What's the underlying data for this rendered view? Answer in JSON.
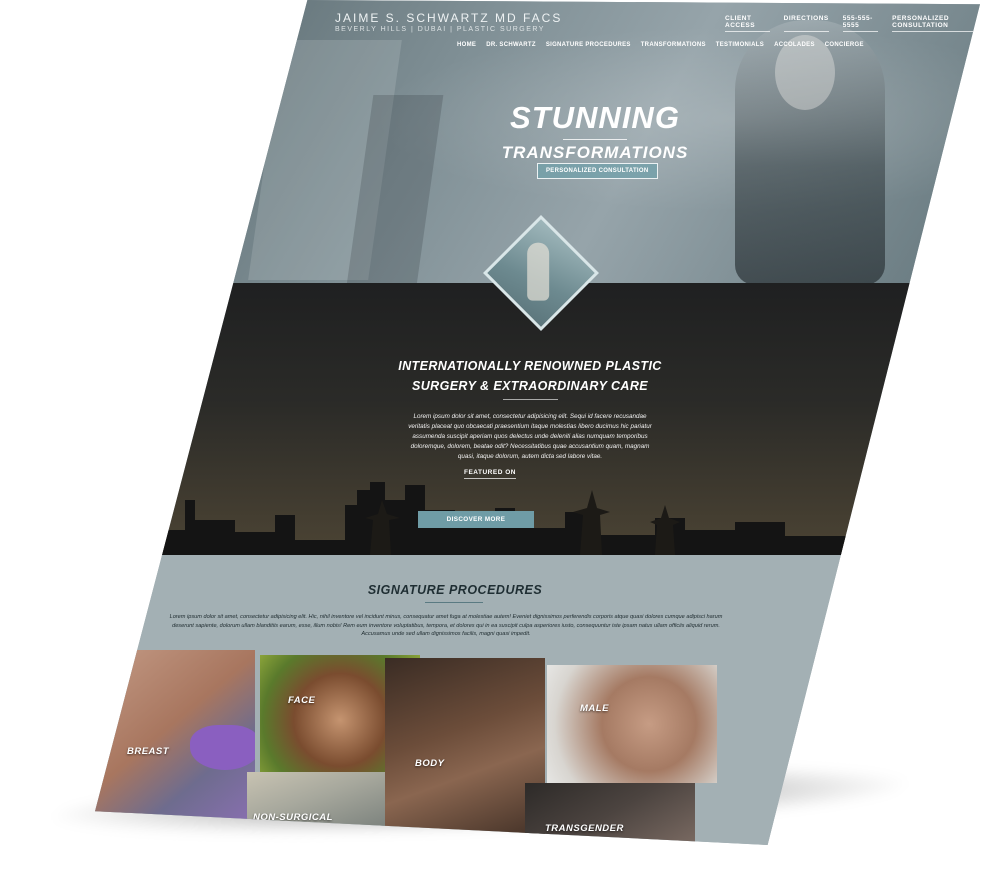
{
  "brand": {
    "name": "JAIME S. SCHWARTZ MD FACS",
    "tagline": "BEVERLY HILLS | DUBAI | PLASTIC SURGERY"
  },
  "utility_nav": [
    {
      "label": "CLIENT ACCESS"
    },
    {
      "label": "DIRECTIONS"
    },
    {
      "label": "555-555-5555"
    },
    {
      "label": "PERSONALIZED CONSULTATION"
    }
  ],
  "main_nav": [
    {
      "label": "HOME"
    },
    {
      "label": "DR. SCHWARTZ"
    },
    {
      "label": "SIGNATURE PROCEDURES"
    },
    {
      "label": "TRANSFORMATIONS"
    },
    {
      "label": "TESTIMONIALS"
    },
    {
      "label": "ACCOLADES"
    },
    {
      "label": "CONCIERGE"
    }
  ],
  "hero": {
    "headline": "STUNNING",
    "subheadline": "TRANSFORMATIONS",
    "cta": "PERSONALIZED CONSULTATION"
  },
  "intro": {
    "title_line1": "INTERNATIONALLY RENOWNED PLASTIC",
    "title_line2": "SURGERY & EXTRAORDINARY CARE",
    "body": "Lorem ipsum dolor sit amet, consectetur adipisicing elit. Sequi id facere recusandae veritatis placeat quo obcaecati praesentium itaque molestias libero ducimus hic pariatur assumenda suscipit aperiam quos delectus unde deleniti alias numquam temporibus doloremque, dolorem, beatae odit? Necessitatibus quae accusantium quam, magnam quasi, itaque dolorum, autem dicta sed labore vitae.",
    "featured_label": "FEATURED ON",
    "discover_button": "DISCOVER MORE"
  },
  "signature": {
    "title": "SIGNATURE PROCEDURES",
    "body": "Lorem ipsum dolor sit amet, consectetur adipisicing elit. Hic, nihil inventore vel incidunt minus, consequatur amet fuga at molestiae autem! Eveniet dignissimos perferendis corporis atque quasi dolores cumque adipisci harum deserunt sapiente, dolorum ullam blanditiis earum, esse, illum nobis! Rem eum inventore voluptatibus, tempora, et dolores qui in ea suscipit culpa asperiores iusto, consequuntur iste ipsam natus ullam officiis aliquid rerum. Accusamus unde sed ullam dignissimos facilis, magni quasi impedit.",
    "tiles": [
      {
        "label": "BREAST"
      },
      {
        "label": "FACE"
      },
      {
        "label": "NON-SURGICAL"
      },
      {
        "label": "BODY"
      },
      {
        "label": "MALE"
      },
      {
        "label": "TRANSGENDER"
      }
    ]
  },
  "colors": {
    "accent": "#6f9ca6",
    "dark_band": "#2b2b28",
    "procedures_bg": "#a3b0b4"
  }
}
